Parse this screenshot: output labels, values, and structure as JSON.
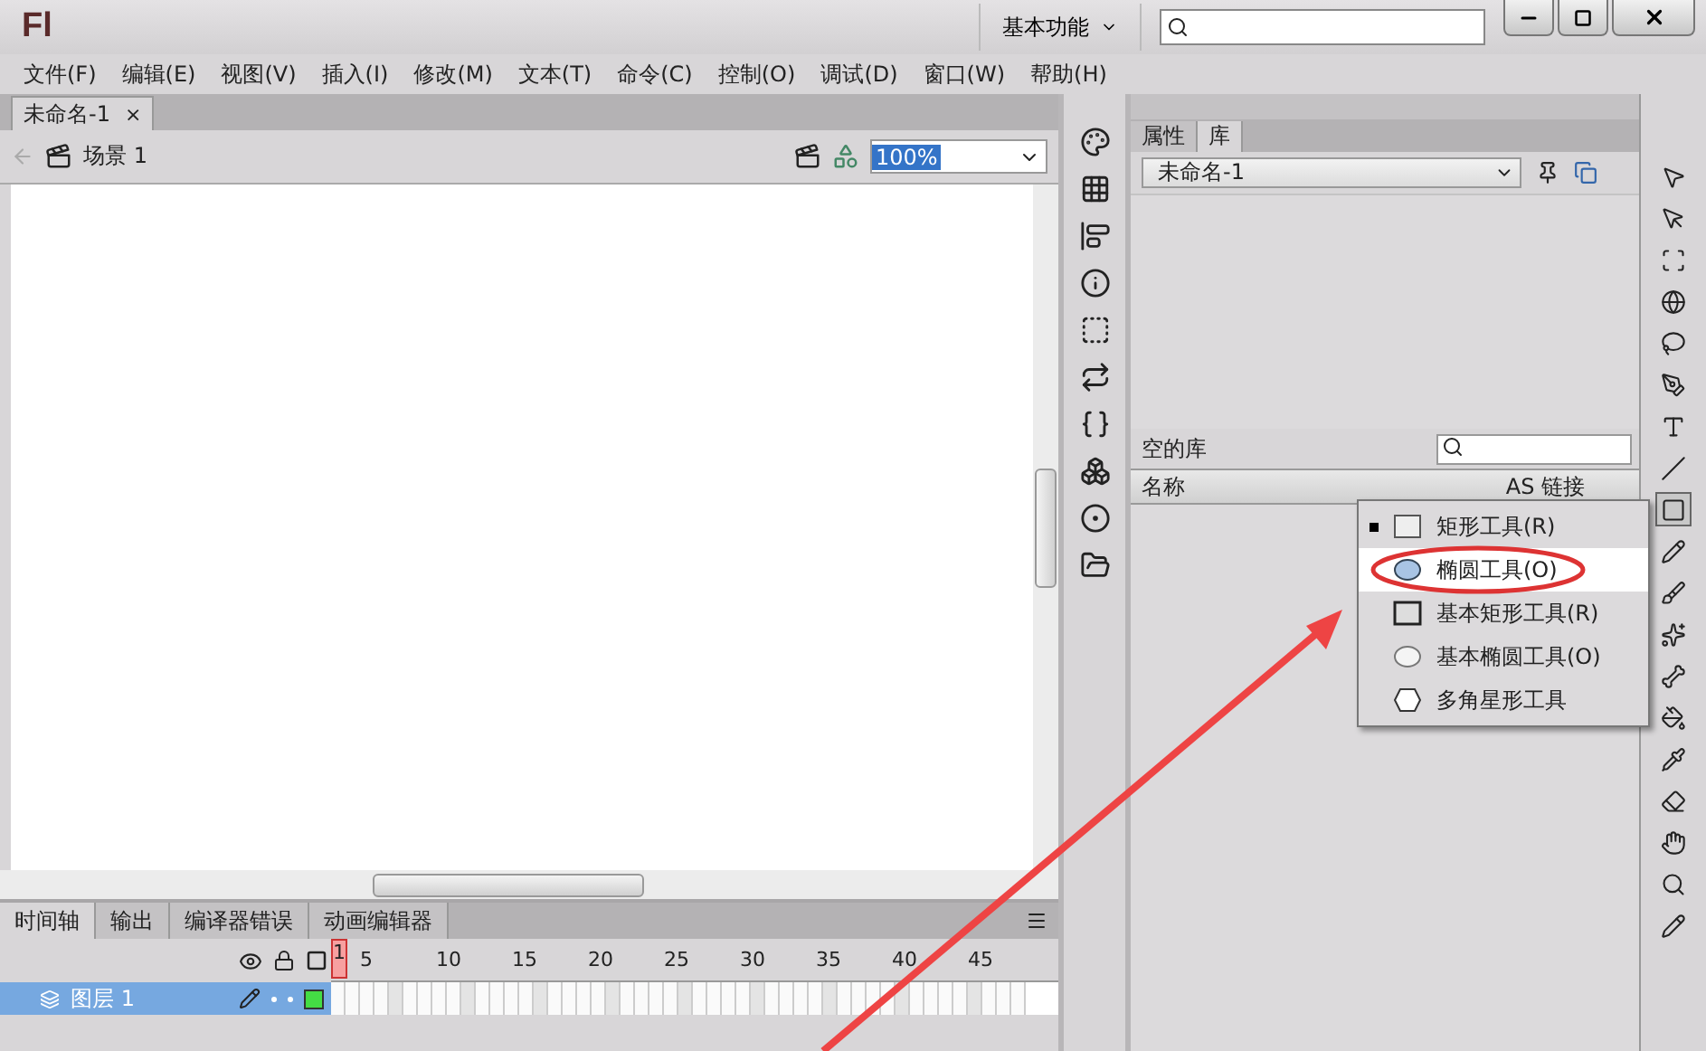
{
  "app": {
    "logo": "Fl",
    "workspace": "基本功能"
  },
  "menu": [
    "文件(F)",
    "编辑(E)",
    "视图(V)",
    "插入(I)",
    "修改(M)",
    "文本(T)",
    "命令(C)",
    "控制(O)",
    "调试(D)",
    "窗口(W)",
    "帮助(H)"
  ],
  "document": {
    "tab": "未命名-1",
    "close": "×",
    "scene": "场景 1",
    "zoom": "100%"
  },
  "timeline": {
    "tabs": [
      {
        "label": "时间轴",
        "selected": true
      },
      {
        "label": "输出",
        "selected": false
      },
      {
        "label": "编译器错误",
        "selected": false
      },
      {
        "label": "动画编辑器",
        "selected": false
      }
    ],
    "playhead": "1",
    "frame_numbers": [
      "5",
      "10",
      "15",
      "20",
      "25",
      "30",
      "35",
      "40",
      "45"
    ],
    "layers": [
      {
        "name": "图层 1",
        "selected": true
      }
    ]
  },
  "library": {
    "tabs": [
      {
        "label": "属性",
        "selected": false
      },
      {
        "label": "库",
        "selected": true
      }
    ],
    "document": "未命名-1",
    "status": "空的库",
    "columns": [
      "名称",
      "AS 链接"
    ]
  },
  "tool_menu": [
    {
      "label": "矩形工具(R)",
      "kind": "rect",
      "current": true,
      "selected": false
    },
    {
      "label": "椭圆工具(O)",
      "kind": "oval",
      "current": false,
      "selected": true
    },
    {
      "label": "基本矩形工具(R)",
      "kind": "prim-rect",
      "current": false,
      "selected": false
    },
    {
      "label": "基本椭圆工具(O)",
      "kind": "prim-oval",
      "current": false,
      "selected": false
    },
    {
      "label": "多角星形工具",
      "kind": "polystar",
      "current": false,
      "selected": false
    }
  ]
}
